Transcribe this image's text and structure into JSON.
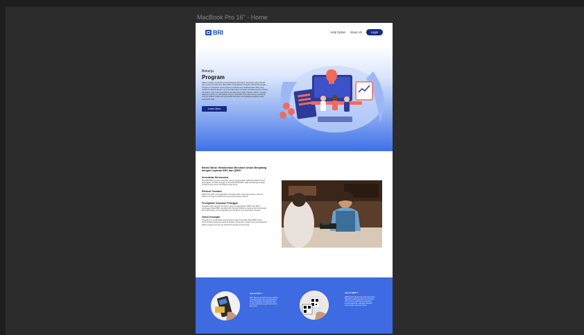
{
  "canvas": {
    "frame_label": "MacBook Pro 16\" - Home"
  },
  "header": {
    "logo_text": "BRI",
    "nav": [
      {
        "label": "Help Option"
      },
      {
        "label": "About Us"
      }
    ],
    "login_label": "Login"
  },
  "hero": {
    "eyebrow": "Bekerja",
    "title": "Program",
    "body": "Dalam rangka mendukung perkembangan ekosistem keuangan yang inklusif dan merata di Indonesia, Bank BRI menghadirkan Program Inklusif Keuangan. Program ini ditujukan secara khusus kepada para Nasabah Bank BRI yang berada di daerah-daerah yang memiliki akses terbatas terhadap layanan Sistem Keuangan Unik Indonesia (Mitra) dan Electronic Data Capture (EDC). Dengan adanya program ini, diharapkan akses untuk BRI bisa hadir secara merata di seluruh wilayah Indonesia yang lebih baik dan meningkatkan kualitas hidup yang lebih baik.",
    "cta_label": "Learn More"
  },
  "features": {
    "title": "Bisnis Mulai: Memberikan Merchant Untuk Menjalang dengan Layanan EDC dan QRIS!",
    "items": [
      {
        "heading": "Kemudahan Bertransaksi",
        "body": "Memiliki EDC berarti merchant yang menggunakan QRIS dan EDC Smart pelanggan, terbukti pengguna tersedia Bank BRI, bagi berbelanja dengan mudah tanpa perlu membawa uang tunai."
      },
      {
        "heading": "Efisiensi Transaksi",
        "body": "QRIS dan EDC meningkatkan transaksi lebih cepat dan efisien, karena tidak perlu lagi menghitung uang tunai secara manual."
      },
      {
        "heading": "Peningkatan Kepuasan Pelanggan",
        "body": "Dengan lebih banyak merchant yang menggunakan QRIS dan EDC, pelanggan Bank BRI memiliki lebih banyak pilihan tempat untuk berbelanja dan berbelanja, memungkinkan kenyamanan dan kepuasan mereka."
      },
      {
        "heading": "Inklusi Keuangan",
        "body": "Program ini memberikan kesempatan bagi komunitas Bank BRI untuk berkontribusi langsung pada ekosistem keuangan negara dan berpartisipasi dalam upaya mendorong inklusi keuangan di Indonesia."
      }
    ]
  },
  "products": [
    {
      "heading": "Apa itu EDC ?",
      "body": "EDC (Electronic Data Capture) adalah perangkat elektronik yang digunakan untuk melakukan pembayaran kartu secara elektronik, seperti kartu kredit atau debit."
    },
    {
      "heading": "Apa itu QRIS ?",
      "body": "QRIS (Quick Response Code Indonesian Standard) adalah standar nasional kode QR untuk memfasilitasi pembayaran secara elektronik, sehingga transaksi lebih mudah, cepat dan aman."
    }
  ],
  "colors": {
    "brand_blue": "#1c4fc4",
    "navy": "#17298a",
    "section_blue": "#3e6be1"
  }
}
